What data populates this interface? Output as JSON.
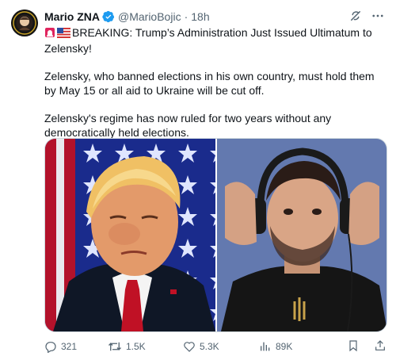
{
  "tweet": {
    "author_name": "Mario ZNA",
    "handle": "@MarioBojic",
    "separator": "·",
    "time": "18h",
    "badge_text": "BREAKING:",
    "headline": "BREAKING: Trump’s Administration Just Issued Ultimatum to Zelensky!",
    "paragraph2": "Zelensky, who banned elections in his own country, must hold them by May 15 or all aid to Ukraine will be cut off.",
    "paragraph3": "Zelensky's regime has now ruled for two years without any democratically held elections.",
    "icons": {
      "verified": "verified-badge-icon",
      "grok": "grok-icon",
      "more": "more-icon",
      "siren": "siren-emoji",
      "flag": "us-flag-emoji"
    }
  },
  "media": {
    "images": [
      {
        "name": "photo-trump",
        "description_hidden": true
      },
      {
        "name": "photo-zelensky",
        "description_hidden": true
      }
    ]
  },
  "actions": {
    "replies": "321",
    "reposts": "1.5K",
    "likes": "5.3K",
    "views": "89K"
  },
  "colors": {
    "text": "#0f1419",
    "secondary": "#536471",
    "verified": "#1d9bf0",
    "border": "#cfd9de"
  }
}
